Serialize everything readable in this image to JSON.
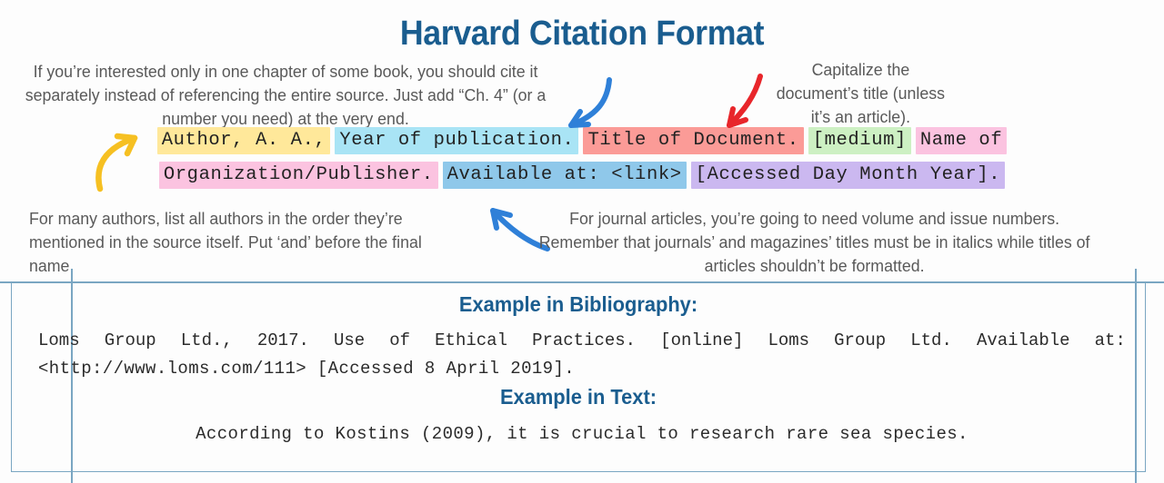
{
  "title": "Harvard Citation Format",
  "notes": {
    "chapter": "If you’re interested only in one chapter of some book, you should cite it separately instead of referencing the entire source. Just add “Ch. 4” (or a number you need) at the very end.",
    "capitalize": "Capitalize the document’s title (unless it’s an article).",
    "authors": "For many authors, list all authors in the order they’re mentioned in the source itself. Put ‘and’ before the final name.",
    "journal": "For journal articles, you’re going to need volume and issue numbers. Remember that journals’ and magazines’ titles must be in italics while titles of articles shouldn’t be formatted."
  },
  "format": {
    "line1": [
      {
        "text": "Author, A. A.,",
        "color": "#ffe89a"
      },
      {
        "text": "Year of publication.",
        "color": "#a9e4f5"
      },
      {
        "text": "Title of Document.",
        "color": "#fb9b97"
      },
      {
        "text": "[medium]",
        "color": "#cdf0c3"
      },
      {
        "text": "Name of",
        "color": "#fbc3e0"
      }
    ],
    "line2": [
      {
        "text": "Organization/Publisher.",
        "color": "#fbc3e0"
      },
      {
        "text": "Available at: <link>",
        "color": "#8fc8ea"
      },
      {
        "text": "[Accessed Day Month Year].",
        "color": "#cbb8f0"
      }
    ]
  },
  "arrows": [
    {
      "name": "yellow-arrow-to-author",
      "color": "#f6c022"
    },
    {
      "name": "blue-arrow-to-year",
      "color": "#2f80d8"
    },
    {
      "name": "red-arrow-to-title",
      "color": "#e8262b"
    },
    {
      "name": "blue-arrow-to-available",
      "color": "#2f80d8"
    }
  ],
  "example_box": {
    "bibliography_heading": "Example in Bibliography:",
    "bibliography_line1_words": [
      "Loms",
      "Group",
      "Ltd.,",
      "2017.",
      "Use",
      "of",
      "Ethical",
      "Practices.",
      "[online]",
      "Loms",
      "Group",
      "Ltd.",
      "Available",
      "at:"
    ],
    "bibliography_line2": "<http://www.loms.com/111> [Accessed 8 April 2019].",
    "text_heading": "Example in Text:",
    "text_line": "According to Kostins (2009), it is crucial to research rare sea species."
  },
  "colors": {
    "title_blue": "#1a5d8f",
    "note_gray": "#595959",
    "box_border": "#7aa6c2"
  }
}
